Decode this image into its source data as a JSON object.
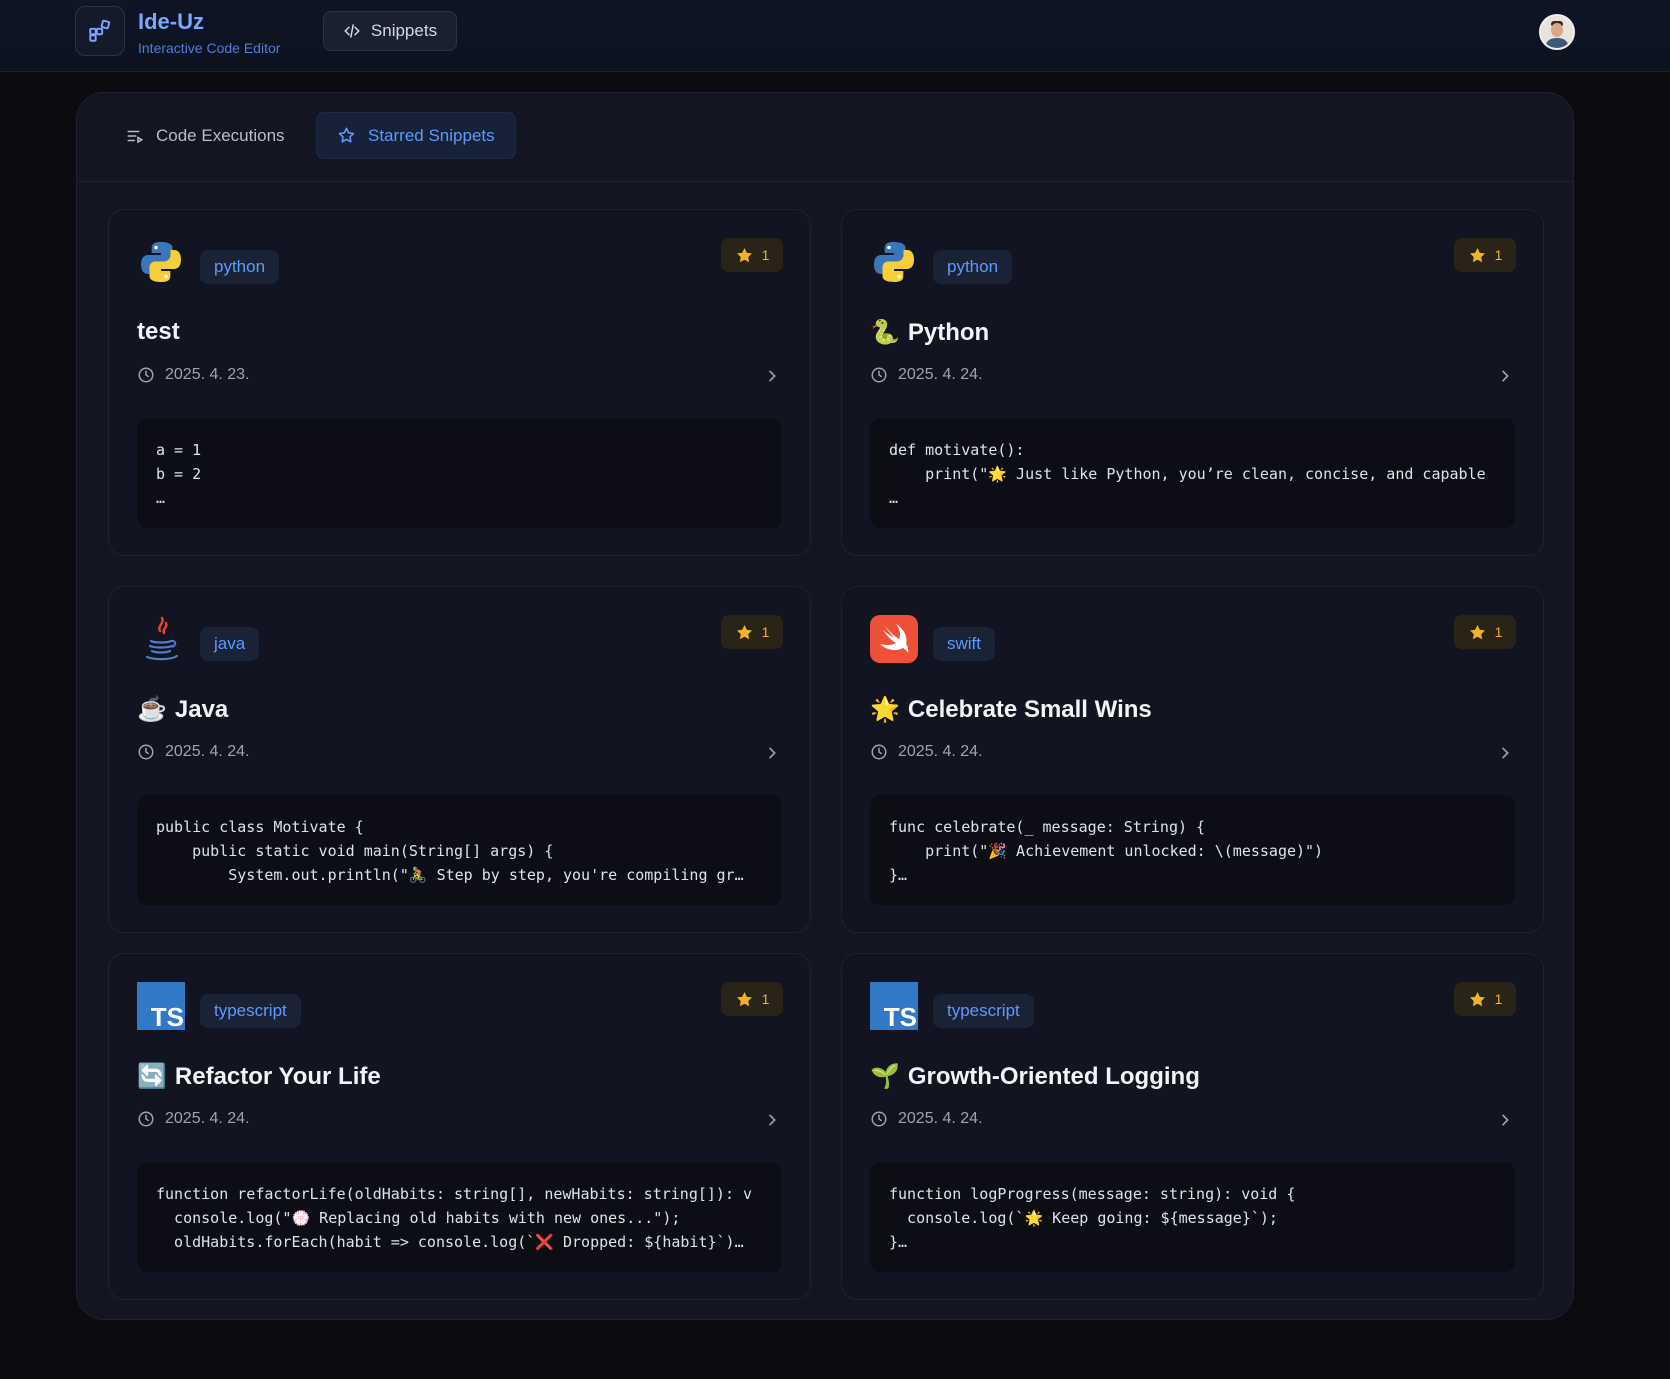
{
  "header": {
    "title": "Ide-Uz",
    "subtitle": "Interactive Code Editor",
    "snippets_label": "Snippets"
  },
  "tabs": [
    {
      "label": "Code Executions",
      "icon": "list-icon"
    },
    {
      "label": "Starred Snippets",
      "icon": "star-outline-icon",
      "active": true
    }
  ],
  "colors": {
    "accent": "#5b9bff",
    "star": "#f0b429",
    "background": "#0b0b10",
    "card": "#121421"
  },
  "snippets": [
    {
      "language": "python",
      "icon": "python-icon",
      "stars": "1",
      "emoji": "",
      "title": "test",
      "date": "2025. 4. 23.",
      "code": [
        "a = 1",
        "b = 2",
        "…"
      ]
    },
    {
      "language": "python",
      "icon": "python-icon",
      "stars": "1",
      "emoji": "🐍",
      "title": "Python",
      "date": "2025. 4. 24.",
      "code": [
        "def motivate():",
        "    print(\"🌟 Just like Python, you’re clean, concise, and capable",
        "…"
      ]
    },
    {
      "language": "java",
      "icon": "java-icon",
      "stars": "1",
      "emoji": "☕",
      "title": "Java",
      "date": "2025. 4. 24.",
      "code": [
        "public class Motivate {",
        "    public static void main(String[] args) {",
        "        System.out.println(\"🚴 Step by step, you're compiling gr…"
      ]
    },
    {
      "language": "swift",
      "icon": "swift-icon",
      "stars": "1",
      "emoji": "🌟",
      "title": "Celebrate Small Wins",
      "date": "2025. 4. 24.",
      "code": [
        "func celebrate(_ message: String) {",
        "    print(\"🎉 Achievement unlocked: \\(message)\")",
        "}…"
      ]
    },
    {
      "language": "typescript",
      "icon": "typescript-icon",
      "stars": "1",
      "emoji": "🔄",
      "title": "Refactor Your Life",
      "date": "2025. 4. 24.",
      "code": [
        "function refactorLife(oldHabits: string[], newHabits: string[]): v",
        "  console.log(\"💮 Replacing old habits with new ones...\");",
        "  oldHabits.forEach(habit => console.log(`❌ Dropped: ${habit}`)…"
      ]
    },
    {
      "language": "typescript",
      "icon": "typescript-icon",
      "stars": "1",
      "emoji": "🌱",
      "title": "Growth-Oriented Logging",
      "date": "2025. 4. 24.",
      "code": [
        "function logProgress(message: string): void {",
        "  console.log(`🌟 Keep going: ${message}`);",
        "}…"
      ]
    }
  ]
}
